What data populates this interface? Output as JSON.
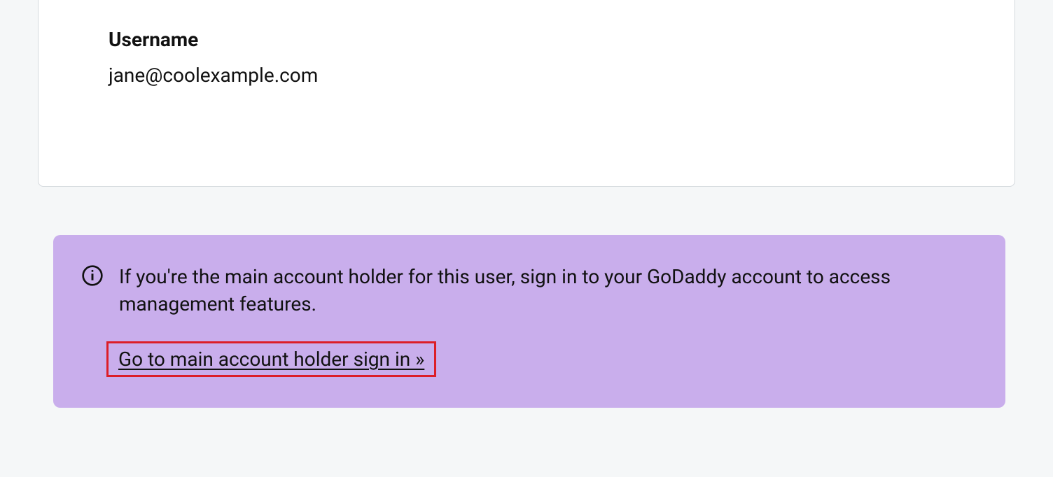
{
  "card": {
    "username_label": "Username",
    "username_value": "jane@coolexample.com"
  },
  "info": {
    "message": "If you're the main account holder for this user, sign in to your GoDaddy account to access management features.",
    "link_text": "Go to main account holder sign in »"
  }
}
